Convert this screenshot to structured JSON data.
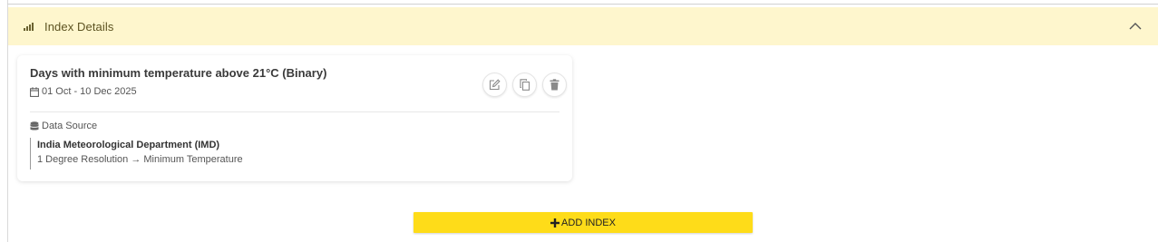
{
  "section": {
    "title": "Index Details",
    "icon": "bar-chart-icon",
    "toggle_icon": "chevron-up-icon",
    "header_color": "#fef6cd"
  },
  "index_card": {
    "title": "Days with minimum temperature above 21°C (Binary)",
    "date_range": "01 Oct - 10 Dec 2025",
    "data_source_label": "Data Source",
    "source_name": "India Meteorological Department (IMD)",
    "source_detail": "1 Degree Resolution → Minimum Temperature",
    "actions": [
      "edit-icon",
      "copy-icon",
      "trash-icon"
    ]
  },
  "add_button": {
    "label": "ADD INDEX",
    "icon": "plus-icon",
    "color": "#fedc19"
  }
}
